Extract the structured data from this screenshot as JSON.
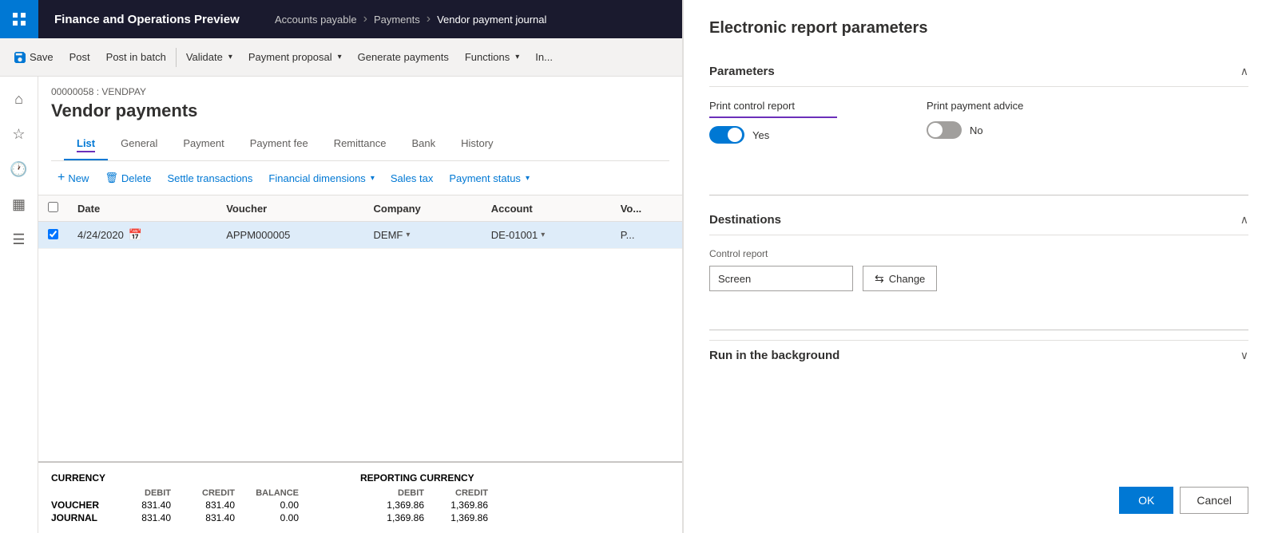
{
  "app": {
    "title": "Finance and Operations Preview",
    "grid_icon": "grid-icon"
  },
  "breadcrumb": {
    "items": [
      "Accounts payable",
      "Payments",
      "Vendor payment journal"
    ]
  },
  "toolbar": {
    "save_label": "Save",
    "post_label": "Post",
    "post_batch_label": "Post in batch",
    "validate_label": "Validate",
    "payment_proposal_label": "Payment proposal",
    "generate_payments_label": "Generate payments",
    "functions_label": "Functions",
    "inquiry_label": "In..."
  },
  "journal": {
    "id": "00000058 : VENDPAY",
    "title": "Vendor payments"
  },
  "tabs": [
    {
      "label": "List",
      "active": true
    },
    {
      "label": "General",
      "active": false
    },
    {
      "label": "Payment",
      "active": false
    },
    {
      "label": "Payment fee",
      "active": false
    },
    {
      "label": "Remittance",
      "active": false
    },
    {
      "label": "Bank",
      "active": false
    },
    {
      "label": "History",
      "active": false
    }
  ],
  "actions": {
    "new_label": "New",
    "delete_label": "Delete",
    "settle_label": "Settle transactions",
    "financial_dim_label": "Financial dimensions",
    "sales_tax_label": "Sales tax",
    "payment_status_label": "Payment status"
  },
  "table": {
    "columns": [
      "Date",
      "Voucher",
      "Company",
      "Account",
      "Vo..."
    ],
    "rows": [
      {
        "date": "4/24/2020",
        "voucher": "APPM000005",
        "company": "DEMF",
        "account": "DE-01001",
        "extra": "P..."
      }
    ]
  },
  "footer": {
    "currency_label": "CURRENCY",
    "reporting_currency_label": "REPORTING CURRENCY",
    "debit_label": "DEBIT",
    "credit_label": "CREDIT",
    "balance_label": "BALANCE",
    "reporting_debit_label": "DEBIT",
    "reporting_credit_label": "CREDIT",
    "rows": [
      {
        "label": "VOUCHER",
        "debit": "831.40",
        "credit": "831.40",
        "balance": "0.00",
        "rep_debit": "1,369.86",
        "rep_credit": "1,369.86"
      },
      {
        "label": "JOURNAL",
        "debit": "831.40",
        "credit": "831.40",
        "balance": "0.00",
        "rep_debit": "1,369.86",
        "rep_credit": "1,369.86"
      }
    ]
  },
  "right_panel": {
    "title": "Electronic report parameters",
    "parameters_section": {
      "label": "Parameters",
      "print_control_report": {
        "label": "Print control report",
        "value": "Yes",
        "is_on": true
      },
      "print_payment_advice": {
        "label": "Print payment advice",
        "value": "No",
        "is_on": false
      }
    },
    "destinations_section": {
      "label": "Destinations",
      "control_report": {
        "label": "Control report",
        "value": "Screen",
        "change_label": "Change"
      }
    },
    "run_background_section": {
      "label": "Run in the background"
    },
    "buttons": {
      "ok_label": "OK",
      "cancel_label": "Cancel"
    }
  }
}
